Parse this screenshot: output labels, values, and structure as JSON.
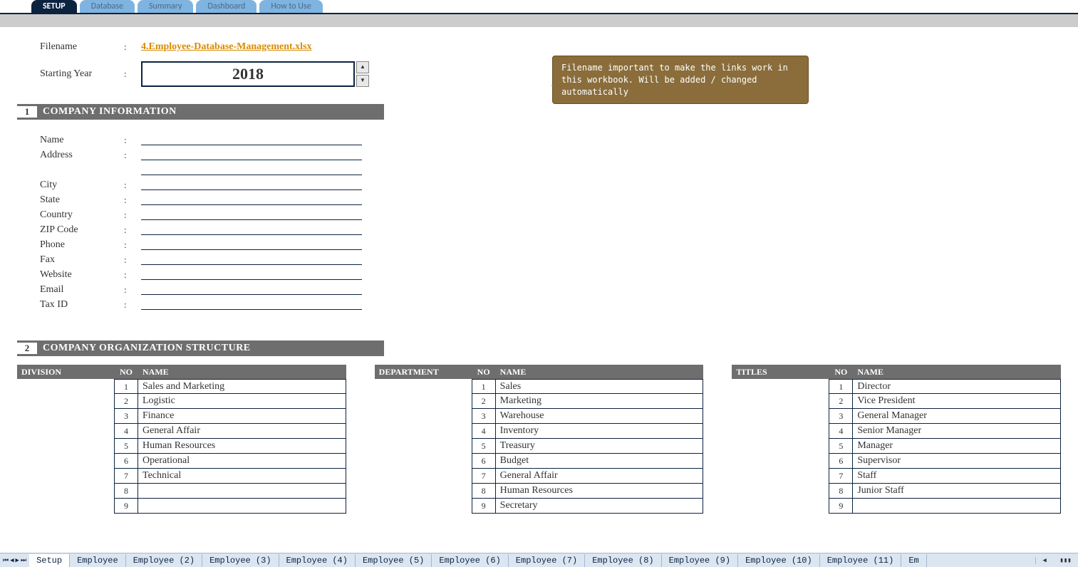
{
  "topTabs": [
    {
      "label": "SETUP",
      "active": true
    },
    {
      "label": "Database",
      "active": false
    },
    {
      "label": "Summary",
      "active": false
    },
    {
      "label": "Dashboard",
      "active": false
    },
    {
      "label": "How to Use",
      "active": false
    }
  ],
  "setup": {
    "filename_label": "Filename",
    "filename_value": "4.Employee-Database-Management.xlsx",
    "startyear_label": "Starting Year",
    "startyear_value": "2018"
  },
  "callout": "Filename important to make the links work in this workbook. Will be added / changed automatically",
  "sections": {
    "s1_num": "1",
    "s1_title": "COMPANY INFORMATION",
    "s2_num": "2",
    "s2_title": "COMPANY ORGANIZATION STRUCTURE"
  },
  "infoFields": [
    "Name",
    "Address",
    "",
    "City",
    "State",
    "Country",
    "ZIP Code",
    "Phone",
    "Fax",
    "Website",
    "Email",
    "Tax ID"
  ],
  "org": {
    "headers": {
      "col1_div": "DIVISION",
      "col1_dep": "DEPARTMENT",
      "col1_tit": "TITLES",
      "no": "NO",
      "name": "NAME"
    },
    "divisions": [
      {
        "no": "1",
        "name": "Sales and Marketing"
      },
      {
        "no": "2",
        "name": "Logistic"
      },
      {
        "no": "3",
        "name": "Finance"
      },
      {
        "no": "4",
        "name": "General Affair"
      },
      {
        "no": "5",
        "name": "Human Resources"
      },
      {
        "no": "6",
        "name": "Operational"
      },
      {
        "no": "7",
        "name": "Technical"
      },
      {
        "no": "8",
        "name": ""
      },
      {
        "no": "9",
        "name": ""
      }
    ],
    "departments": [
      {
        "no": "1",
        "name": "Sales"
      },
      {
        "no": "2",
        "name": "Marketing"
      },
      {
        "no": "3",
        "name": "Warehouse"
      },
      {
        "no": "4",
        "name": "Inventory"
      },
      {
        "no": "5",
        "name": "Treasury"
      },
      {
        "no": "6",
        "name": "Budget"
      },
      {
        "no": "7",
        "name": "General Affair"
      },
      {
        "no": "8",
        "name": "Human Resources"
      },
      {
        "no": "9",
        "name": "Secretary"
      }
    ],
    "titles": [
      {
        "no": "1",
        "name": "Director"
      },
      {
        "no": "2",
        "name": "Vice President"
      },
      {
        "no": "3",
        "name": "General Manager"
      },
      {
        "no": "4",
        "name": "Senior Manager"
      },
      {
        "no": "5",
        "name": "Manager"
      },
      {
        "no": "6",
        "name": "Supervisor"
      },
      {
        "no": "7",
        "name": "Staff"
      },
      {
        "no": "8",
        "name": "Junior Staff"
      },
      {
        "no": "9",
        "name": ""
      }
    ]
  },
  "sheets": [
    "Setup",
    "Employee",
    "Employee (2)",
    "Employee (3)",
    "Employee (4)",
    "Employee (5)",
    "Employee (6)",
    "Employee (7)",
    "Employee (8)",
    "Employee (9)",
    "Employee (10)",
    "Employee (11)",
    "Em"
  ]
}
